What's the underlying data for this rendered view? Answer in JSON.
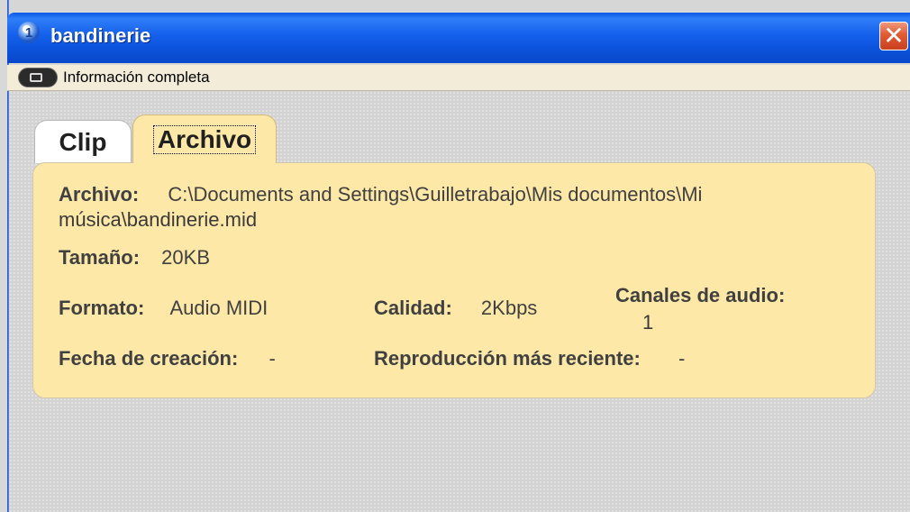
{
  "window": {
    "title": "bandinerie",
    "close_glyph": "✕",
    "app_icon_glyph": "1"
  },
  "infobar": {
    "label": "Información completa",
    "icon": "info-display-icon"
  },
  "tabs": [
    {
      "label": "Clip",
      "selected": false
    },
    {
      "label": "Archivo",
      "selected": true
    }
  ],
  "details": {
    "archivo_label": "Archivo:",
    "archivo_value_line1": "C:\\Documents and Settings\\Guilletrabajo\\Mis documentos\\Mi",
    "archivo_value_line2": "música\\bandinerie.mid",
    "tamano_label": "Tamaño:",
    "tamano_value": "20KB",
    "formato_label": "Formato:",
    "formato_value": "Audio MIDI",
    "calidad_label": "Calidad:",
    "calidad_value": "2Kbps",
    "canales_label": "Canales de audio:",
    "canales_value": "1",
    "fecha_label": "Fecha de creación:",
    "fecha_value": "-",
    "reproduccion_label": "Reproducción más reciente:",
    "reproduccion_value": "-"
  },
  "colors": {
    "titlebar": "#0a5ae8",
    "panel": "#fde8a8",
    "close": "#e05a33"
  }
}
